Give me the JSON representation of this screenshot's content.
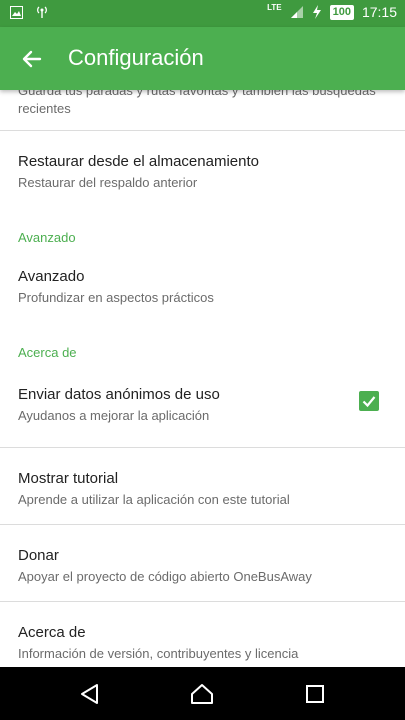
{
  "status_bar": {
    "network": "LTE",
    "battery": "100",
    "time": "17:15"
  },
  "app_bar": {
    "title": "Configuración"
  },
  "top_item": {
    "summary_line1": "Guarda tus paradas y rutas favoritas y también las búsquedas",
    "summary_line2": "recientes"
  },
  "restore": {
    "title": "Restaurar desde el almacenamiento",
    "summary": "Restaurar del respaldo anterior"
  },
  "section_advanced": {
    "header": "Avanzado",
    "title": "Avanzado",
    "summary": "Profundizar en aspectos prácticos"
  },
  "section_about": {
    "header": "Acerca de",
    "analytics": {
      "title": "Enviar datos anónimos de uso",
      "summary": "Ayudanos a mejorar la aplicación",
      "checked": true
    },
    "tutorial": {
      "title": "Mostrar tutorial",
      "summary": "Aprende a utilizar la aplicación con este tutorial"
    },
    "donate": {
      "title": "Donar",
      "summary": "Apoyar el proyecto de código abierto OneBusAway"
    },
    "about": {
      "title": "Acerca de",
      "summary": "Información de versión, contribuyentes y licencia"
    }
  },
  "colors": {
    "status_bar": "#3f9a3f",
    "app_bar": "#4caf50",
    "accent": "#4caf50"
  }
}
